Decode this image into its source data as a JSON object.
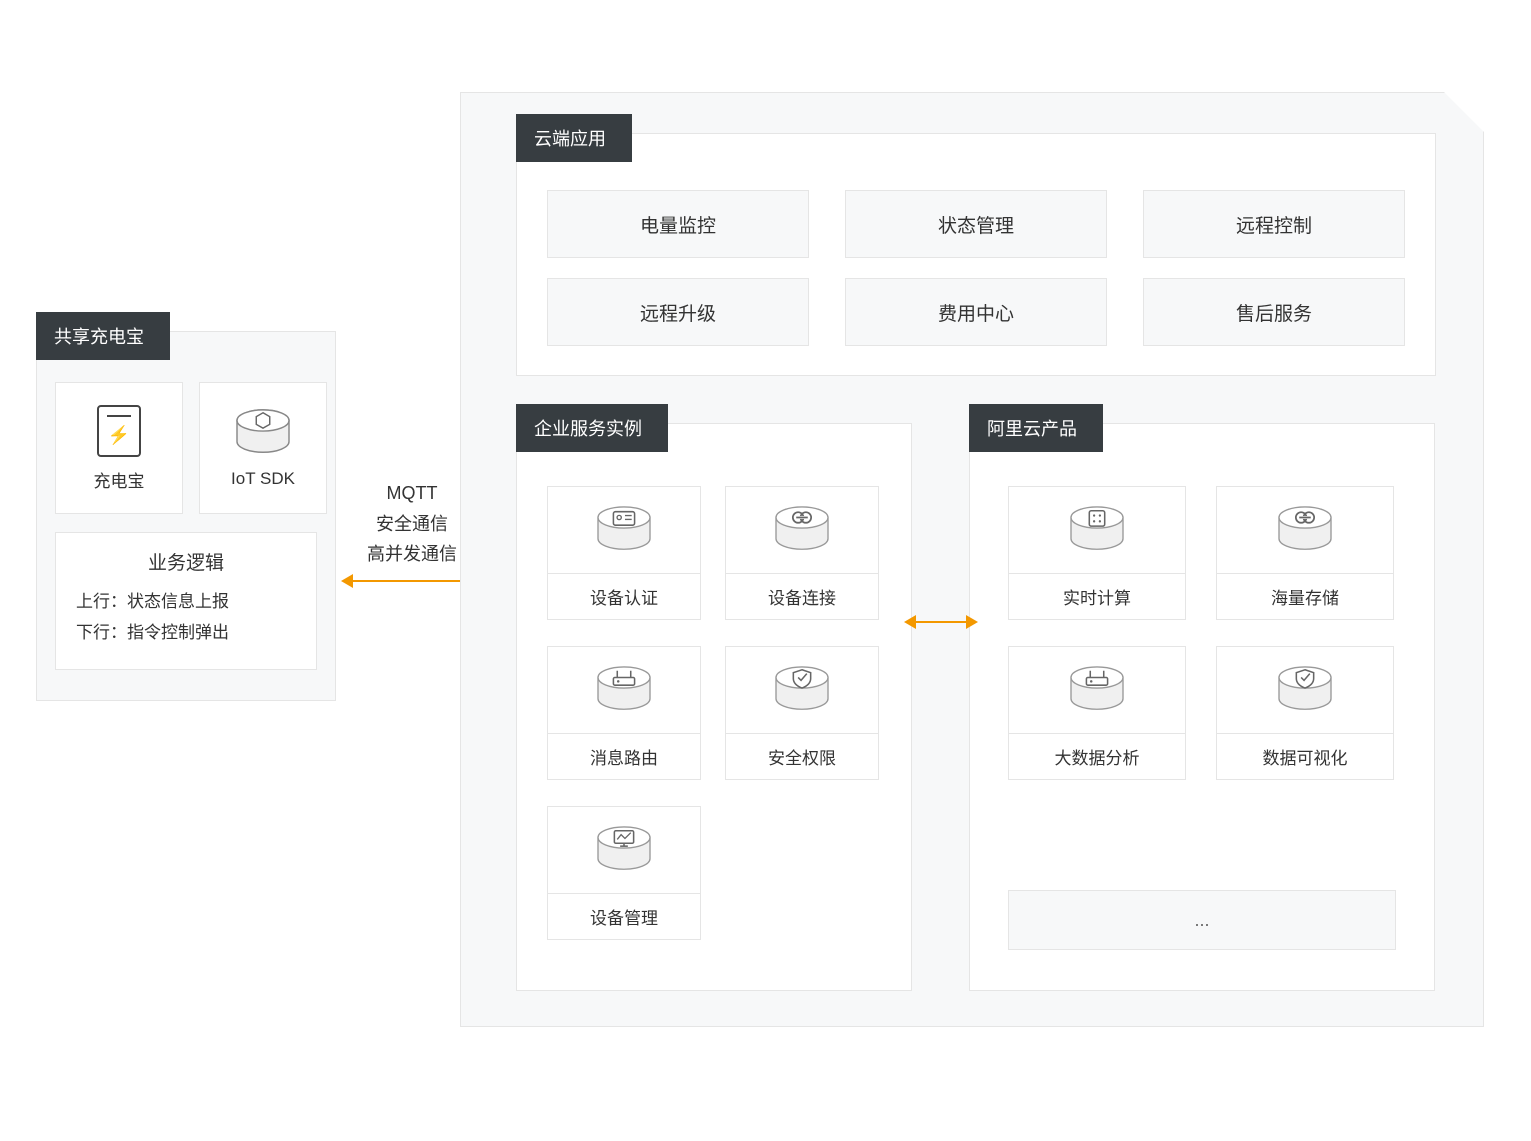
{
  "left_box": {
    "title": "共享充电宝",
    "device_label": "充电宝",
    "sdk_label": "IoT SDK",
    "business": {
      "title": "业务逻辑",
      "up": "上行：状态信息上报",
      "down": "下行：指令控制弹出"
    }
  },
  "connection": {
    "protocol": "MQTT",
    "line2": "安全通信",
    "line3": "高并发通信"
  },
  "cloud_apps": {
    "title": "云端应用",
    "items": [
      "电量监控",
      "状态管理",
      "远程控制",
      "远程升级",
      "费用中心",
      "售后服务"
    ]
  },
  "enterprise": {
    "title": "企业服务实例",
    "items": [
      "设备认证",
      "设备连接",
      "消息路由",
      "安全权限",
      "设备管理"
    ]
  },
  "aliyun": {
    "title": "阿里云产品",
    "items": [
      "实时计算",
      "海量存储",
      "大数据分析",
      "数据可视化"
    ],
    "ellipsis": "..."
  }
}
